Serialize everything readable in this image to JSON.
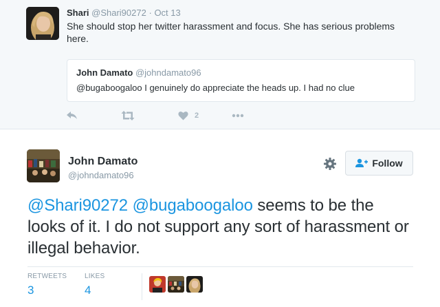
{
  "parent_tweet": {
    "author_name": "Shari",
    "author_handle": "@Shari90272",
    "separator": "·",
    "date": "Oct 13",
    "text": "She should stop her twitter harassment and focus. She has serious problems here.",
    "quoted": {
      "author_name": "John Damato",
      "author_handle": "@johndamato96",
      "text": "@bugaboogaloo I genuinely do appreciate the heads up. I had no clue"
    },
    "actions": {
      "reply_icon": "reply-icon",
      "retweet_icon": "retweet-icon",
      "like_icon": "heart-icon",
      "like_count": "2",
      "more_icon": "more-icon"
    }
  },
  "main_tweet": {
    "author_name": "John Damato",
    "author_handle": "@johndamato96",
    "settings_icon": "gear-icon",
    "follow_label": "Follow",
    "text_parts": {
      "mention1": "@Shari90272",
      "mention2": "@bugaboogaloo",
      "body": " seems to be the looks of it. I do not support any sort of harassment or illegal behavior."
    },
    "stats": {
      "retweets_label": "RETWEETS",
      "retweets_value": "3",
      "likes_label": "LIKES",
      "likes_value": "4"
    },
    "likers_count_shown": 3
  },
  "colors": {
    "link": "#1b95e0",
    "muted": "#8899a6",
    "text": "#292f33",
    "parent_bg": "#f5f8fa",
    "border": "#e1e8ed",
    "action_icon": "#aab8c2"
  }
}
